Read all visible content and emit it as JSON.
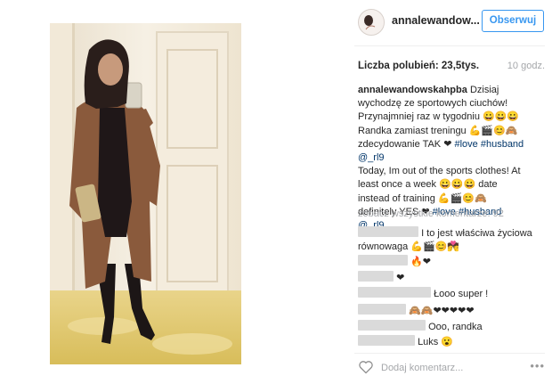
{
  "post": {
    "username": "annalewandow...",
    "follow_label": "Obserwuj",
    "likes_label": "Liczba polubień: 23,5tys.",
    "time_ago": "10 godz.",
    "caption_user": "annalewandowskahpba",
    "caption_pl_1": "Dzisiaj wychodzę ze sportowych ciuchów! Przynajmniej raz w tygodniu 😀😀😀 Randka zamiast treningu 💪🎬😊🙈 zdecydowanie TAK ❤ ",
    "tag_love": "#love",
    "tag_husband": "#husband",
    "mention_rl9": "@_rl9",
    "caption_en_1": "Today, Im out of the sports clothes! At least once a week 😀😀😀 date instead of training 💪🎬😊🙈 definitely YES ❤ ",
    "view_all": "zobacz wszystkie komentarze: 92",
    "add_comment_placeholder": "Dodaj komentarz...",
    "more_label": "•••"
  },
  "comments": [
    {
      "text": "I to jest właściwa życiowa równowaga 💪🎬😊💏"
    },
    {
      "text": "🔥❤"
    },
    {
      "text": "❤"
    },
    {
      "text": "Łooo super !"
    },
    {
      "text": "🙈🙈❤❤❤❤❤"
    },
    {
      "text": "Ooo, randka"
    },
    {
      "text": "Luks 😮"
    }
  ],
  "colors": {
    "accent": "#3897f0",
    "hashtag": "#003569",
    "muted": "#a5a7aa",
    "text": "#262626"
  },
  "icons": {
    "heart": "heart-outline-icon",
    "more": "more-options-icon"
  }
}
